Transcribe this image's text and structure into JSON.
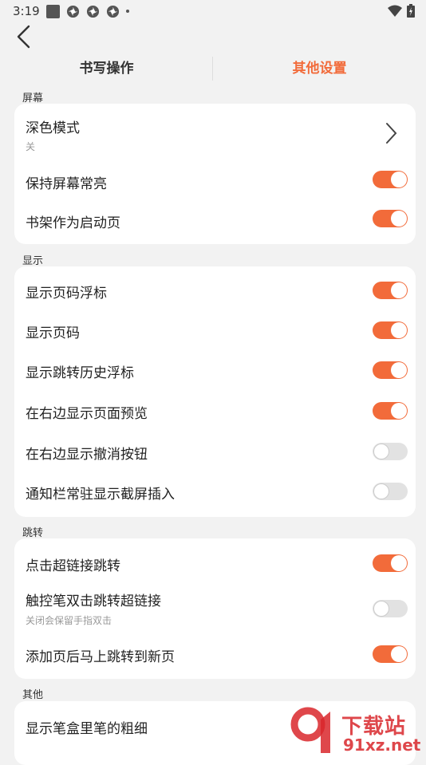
{
  "status": {
    "time": "3:19"
  },
  "tabs": [
    {
      "label": "书写操作",
      "active": false
    },
    {
      "label": "其他设置",
      "active": true
    }
  ],
  "sections": [
    {
      "title": "屏幕"
    },
    {
      "title": "显示"
    },
    {
      "title": "跳转"
    },
    {
      "title": "其他"
    }
  ],
  "screen": {
    "dark_mode": {
      "label": "深色模式",
      "value": "关"
    },
    "keep_screen_on": {
      "label": "保持屏幕常亮",
      "on": true
    },
    "bookshelf_start": {
      "label": "书架作为启动页",
      "on": true
    }
  },
  "display": {
    "items": [
      {
        "label": "显示页码浮标",
        "on": true
      },
      {
        "label": "显示页码",
        "on": true
      },
      {
        "label": "显示跳转历史浮标",
        "on": true
      },
      {
        "label": "在右边显示页面预览",
        "on": true
      },
      {
        "label": "在右边显示撤消按钮",
        "on": false
      },
      {
        "label": "通知栏常驻显示截屏插入",
        "on": false
      }
    ]
  },
  "jump": {
    "items": [
      {
        "label": "点击超链接跳转",
        "on": true
      },
      {
        "label": "触控笔双击跳转超链接",
        "sub": "关闭会保留手指双击",
        "on": false
      },
      {
        "label": "添加页后马上跳转到新页",
        "on": true
      }
    ]
  },
  "other": {
    "items": [
      {
        "label": "显示笔盒里笔的粗细"
      }
    ]
  },
  "watermark": {
    "text": "下载站",
    "url": "91xz.net"
  },
  "colors": {
    "accent": "#f26b3a",
    "watermark": "#d9272c"
  }
}
